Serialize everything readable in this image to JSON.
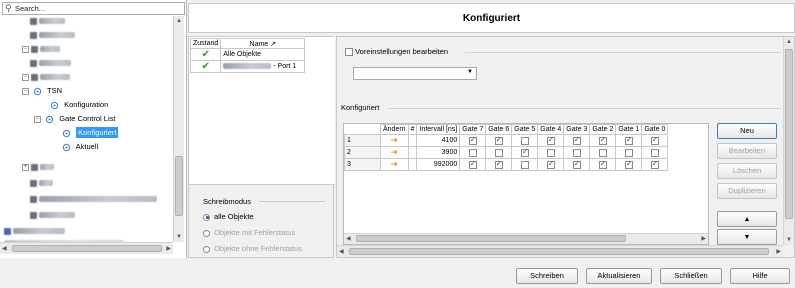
{
  "search": {
    "placeholder": "Search..."
  },
  "tree": {
    "items": [
      {
        "label": "TSN"
      },
      {
        "label": "Konfiguration"
      },
      {
        "label": "Gate Control List"
      },
      {
        "label": "Konfiguriert"
      },
      {
        "label": "Aktuell"
      }
    ]
  },
  "list": {
    "headers": [
      "Zustand",
      "Name"
    ],
    "rows": [
      {
        "name": "Alle Objekte"
      },
      {
        "name": "- Port 1"
      }
    ]
  },
  "schreibmodus": {
    "title": "Schreibmodus",
    "options": [
      "alle Objekte",
      "Objekte mit Fehlerstatus",
      "Objekte ohne Fehlerstatus"
    ]
  },
  "main": {
    "title": "Konfiguriert",
    "voreinstellungen": "Voreinstellungen bearbeiten",
    "section": "Konfiguriert",
    "grid": {
      "headers": [
        "Ändern",
        "#",
        "Intervall [ns]",
        "Gate 7",
        "Gate 6",
        "Gate 5",
        "Gate 4",
        "Gate 3",
        "Gate 2",
        "Gate 1",
        "Gate 0"
      ],
      "rows": [
        {
          "n": "1",
          "interval": "4100",
          "gates": [
            true,
            true,
            false,
            true,
            true,
            true,
            true,
            true
          ]
        },
        {
          "n": "2",
          "interval": "3900",
          "gates": [
            false,
            false,
            true,
            false,
            false,
            false,
            false,
            false
          ]
        },
        {
          "n": "3",
          "interval": "992000",
          "gates": [
            true,
            true,
            false,
            true,
            true,
            true,
            true,
            true
          ]
        }
      ]
    },
    "side_buttons": [
      "Neu",
      "Bearbeiten",
      "Löschen",
      "Duplizieren"
    ]
  },
  "footer": {
    "buttons": [
      "Schreiben",
      "Aktualisieren",
      "Schließen",
      "Hilfe"
    ]
  }
}
